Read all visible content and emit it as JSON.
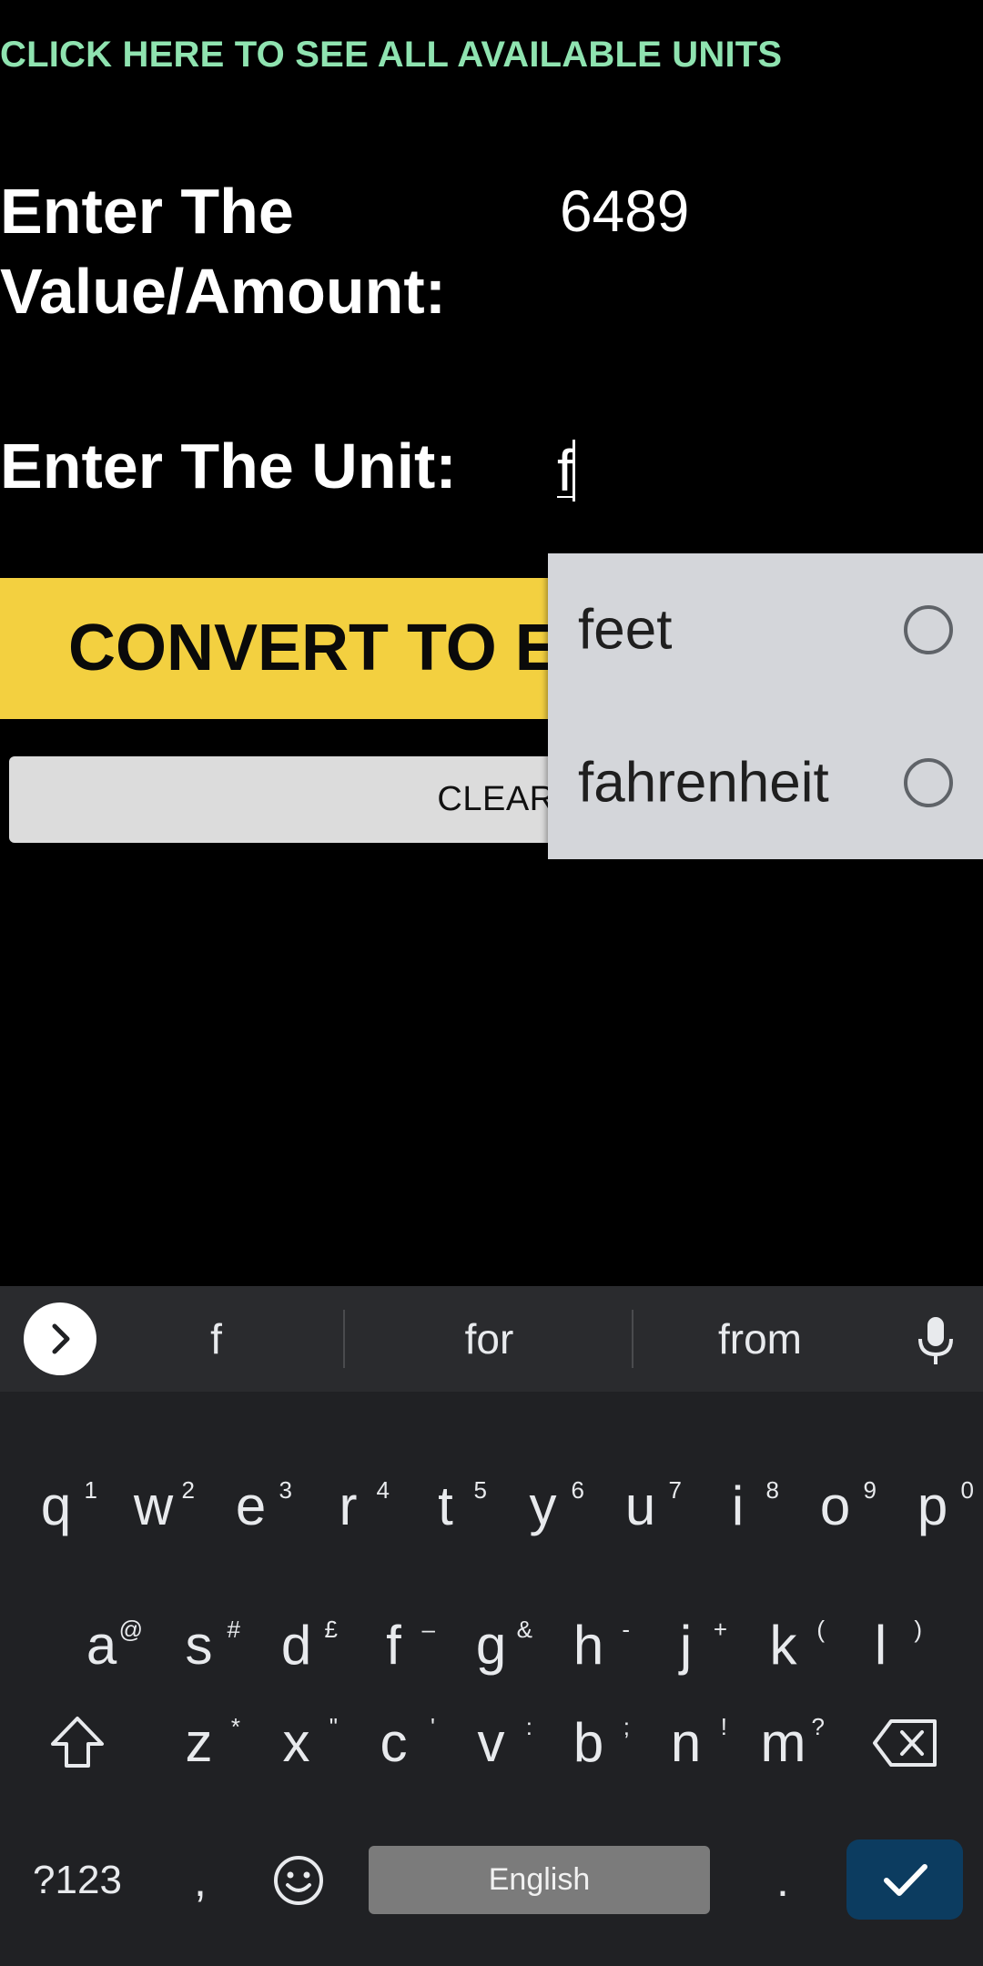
{
  "app": {
    "units_link": "CLICK HERE TO SEE ALL AVAILABLE UNITS",
    "value_label": "Enter The Value/Amount:",
    "value_input": "6489",
    "unit_label": "Enter The Unit:",
    "unit_input": "f",
    "convert_button": "CONVERT TO EVERY UNIT",
    "clear_button": "CLEAR"
  },
  "dropdown": {
    "options": [
      "feet",
      "fahrenheit"
    ]
  },
  "keyboard": {
    "suggestions": [
      "f",
      "for",
      "from"
    ],
    "row1": [
      {
        "k": "q",
        "h": "1"
      },
      {
        "k": "w",
        "h": "2"
      },
      {
        "k": "e",
        "h": "3"
      },
      {
        "k": "r",
        "h": "4"
      },
      {
        "k": "t",
        "h": "5"
      },
      {
        "k": "y",
        "h": "6"
      },
      {
        "k": "u",
        "h": "7"
      },
      {
        "k": "i",
        "h": "8"
      },
      {
        "k": "o",
        "h": "9"
      },
      {
        "k": "p",
        "h": "0"
      }
    ],
    "row2": [
      {
        "k": "a",
        "h": "@"
      },
      {
        "k": "s",
        "h": "#"
      },
      {
        "k": "d",
        "h": "£"
      },
      {
        "k": "f",
        "h": "–"
      },
      {
        "k": "g",
        "h": "&"
      },
      {
        "k": "h",
        "h": "-"
      },
      {
        "k": "j",
        "h": "+"
      },
      {
        "k": "k",
        "h": "("
      },
      {
        "k": "l",
        "h": ")"
      }
    ],
    "row3": [
      {
        "k": "z",
        "h": "*"
      },
      {
        "k": "x",
        "h": "\""
      },
      {
        "k": "c",
        "h": "'"
      },
      {
        "k": "v",
        "h": ":"
      },
      {
        "k": "b",
        "h": ";"
      },
      {
        "k": "n",
        "h": "!"
      },
      {
        "k": "m",
        "h": "?"
      }
    ],
    "symbols_key": "?123",
    "comma_key": ",",
    "space_key": "English",
    "period_key": ".",
    "icons": [
      "expand-suggestions-icon",
      "mic-icon",
      "shift-icon",
      "backspace-icon",
      "emoji-icon",
      "checkmark-icon"
    ]
  }
}
